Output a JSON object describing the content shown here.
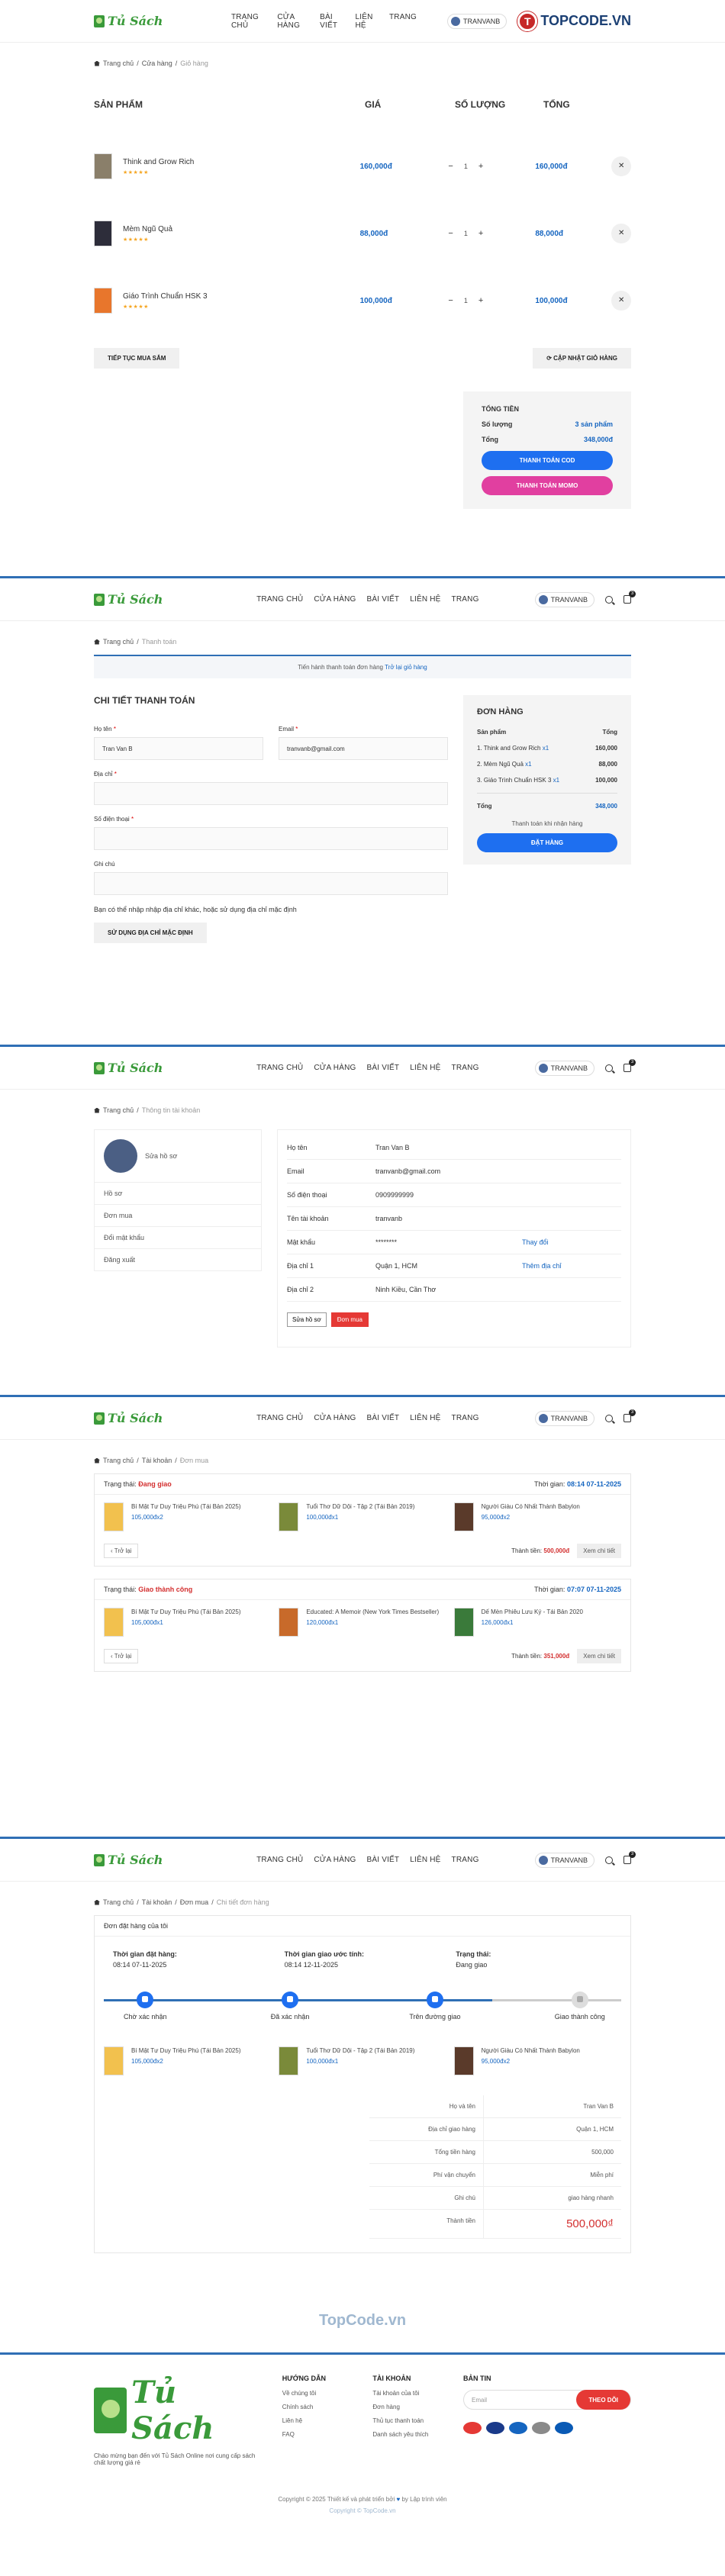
{
  "header": {
    "logo": "Tủ Sách",
    "nav": [
      "TRANG CHỦ",
      "CỬA HÀNG",
      "BÀI VIẾT",
      "LIÊN HỆ",
      "TRANG"
    ],
    "user": "TRANVANB",
    "cart_count": "3",
    "topcode": "TOPCODE.VN"
  },
  "cart": {
    "breadcrumb": [
      "Trang chủ",
      "Cửa hàng",
      "Giỏ hàng"
    ],
    "cols": [
      "SẢN PHẨM",
      "GIÁ",
      "SỐ LƯỢNG",
      "TỔNG"
    ],
    "items": [
      {
        "name": "Think and Grow Rich",
        "price": "160,000đ",
        "qty": "1",
        "total": "160,000đ",
        "color": "#8a7f6a"
      },
      {
        "name": "Mèm Ngũ Quả",
        "price": "88,000đ",
        "qty": "1",
        "total": "88,000đ",
        "color": "#2d2d3a"
      },
      {
        "name": "Giáo Trình Chuẩn HSK 3",
        "price": "100,000đ",
        "qty": "1",
        "total": "100,000đ",
        "color": "#e8762c"
      }
    ],
    "stars": "★★★★★",
    "minus": "−",
    "plus": "+",
    "remove": "✕",
    "continue": "TIẾP TỤC MUA SẮM",
    "update": "⟳ CẬP NHẬT GIỎ HÀNG",
    "totals_title": "TỔNG TIỀN",
    "qty_label": "Số lượng",
    "qty_value": "3 sản phẩm",
    "total_label": "Tổng",
    "total_value": "348,000đ",
    "cod": "THANH TOÁN COD",
    "momo": "THANH TOÁN MOMO"
  },
  "checkout": {
    "breadcrumb": [
      "Trang chủ",
      "Thanh toán"
    ],
    "notice": "Tiến hành thanh toán đơn hàng",
    "notice_link": "Trở lại giỏ hàng",
    "title": "CHI TIẾT THANH TOÁN",
    "name_label": "Họ tên",
    "name_value": "Tran Van B",
    "email_label": "Email",
    "email_value": "tranvanb@gmail.com",
    "address_label": "Địa chỉ",
    "phone_label": "Số điện thoại",
    "note_label": "Ghi chú",
    "alt_note": "Bạn có thể nhập nhập địa chỉ khác, hoặc sử dụng địa chỉ mặc định",
    "use_default": "SỬ DỤNG ĐỊA CHỈ MẶC ĐỊNH",
    "order_title": "ĐƠN HÀNG",
    "col_product": "Sản phẩm",
    "col_total": "Tổng",
    "lines": [
      {
        "name": "1. Think and Grow Rich",
        "qty": "x1",
        "price": "160,000"
      },
      {
        "name": "2. Mèm Ngũ Quả",
        "qty": "x1",
        "price": "88,000"
      },
      {
        "name": "3. Giáo Trình Chuẩn HSK 3",
        "qty": "x1",
        "price": "100,000"
      }
    ],
    "sum_label": "Tổng",
    "sum_value": "348,000",
    "pay_method": "Thanh toán khi nhận hàng",
    "place_order": "ĐẶT HÀNG"
  },
  "account": {
    "breadcrumb": [
      "Trang chủ",
      "Thông tin tài khoản"
    ],
    "edit": "Sửa hồ sơ",
    "menu": [
      "Hồ sơ",
      "Đơn mua",
      "Đổi mật khẩu",
      "Đăng xuất"
    ],
    "rows": [
      {
        "k": "Họ tên",
        "v": "Tran Van B",
        "a": ""
      },
      {
        "k": "Email",
        "v": "tranvanb@gmail.com",
        "a": ""
      },
      {
        "k": "Số điện thoại",
        "v": "0909999999",
        "a": ""
      },
      {
        "k": "Tên tài khoản",
        "v": "tranvanb",
        "a": ""
      },
      {
        "k": "Mật khẩu",
        "v": "********",
        "a": "Thay đổi"
      },
      {
        "k": "Địa chỉ 1",
        "v": "Quận 1, HCM",
        "a": "Thêm địa chỉ"
      },
      {
        "k": "Địa chỉ 2",
        "v": "Ninh Kiều, Cần Thơ",
        "a": ""
      }
    ],
    "btn_edit": "Sửa hồ sơ",
    "btn_orders": "Đơn mua"
  },
  "orders": {
    "breadcrumb": [
      "Trang chủ",
      "Tài khoản",
      "Đơn mua"
    ],
    "status_label": "Trạng thái:",
    "time_label": "Thời gian:",
    "total_label": "Thành tiền:",
    "back": "‹ Trở lại",
    "view": "Xem chi tiết",
    "list": [
      {
        "status": "Đang giao",
        "time": "08:14 07-11-2025",
        "total": "500,000đ",
        "items": [
          {
            "name": "Bí Mật Tư Duy Triệu Phú (Tái Bản 2025)",
            "price": "105,000đ",
            "qty": "x2",
            "color": "#f2c14e"
          },
          {
            "name": "Tuổi Thơ Dữ Dội - Tập 2 (Tái Bản 2019)",
            "price": "100,000đ",
            "qty": "x1",
            "color": "#7a8a3a"
          },
          {
            "name": "Người Giàu Có Nhất Thành Babylon",
            "price": "95,000đ",
            "qty": "x2",
            "color": "#5a3a2a"
          }
        ]
      },
      {
        "status": "Giao thành công",
        "time": "07:07 07-11-2025",
        "total": "351,000đ",
        "items": [
          {
            "name": "Bí Mật Tư Duy Triệu Phú (Tái Bản 2025)",
            "price": "105,000đ",
            "qty": "x1",
            "color": "#f2c14e"
          },
          {
            "name": "Educated: A Memoir (New York Times Bestseller)",
            "price": "120,000đ",
            "qty": "x1",
            "color": "#c86a2a"
          },
          {
            "name": "Dế Mèn Phiêu Lưu Ký - Tái Bản 2020",
            "price": "126,000đ",
            "qty": "x1",
            "color": "#3a7a3a"
          }
        ]
      }
    ]
  },
  "detail": {
    "breadcrumb": [
      "Trang chủ",
      "Tài khoản",
      "Đơn mua",
      "Chi tiết đơn hàng"
    ],
    "title": "Đơn đặt hàng của tôi",
    "placed_label": "Thời gian đặt hàng:",
    "placed": "08:14 07-11-2025",
    "eta_label": "Thời gian giao ước tính:",
    "eta": "08:14 12-11-2025",
    "status_label": "Trạng thái:",
    "status": "Đang giao",
    "steps": [
      "Chờ xác nhận",
      "Đã xác nhận",
      "Trên đường giao",
      "Giao thành công"
    ],
    "summary": [
      {
        "k": "Họ và tên",
        "v": "Tran Van B"
      },
      {
        "k": "Địa chỉ giao hàng",
        "v": "Quận 1, HCM"
      },
      {
        "k": "Tổng tiền hàng",
        "v": "500,000"
      },
      {
        "k": "Phí vận chuyển",
        "v": "Miễn phí"
      },
      {
        "k": "Ghi chú",
        "v": "giao hàng nhanh"
      }
    ],
    "grand_label": "Thành tiền",
    "grand": "500,000₫"
  },
  "footer": {
    "watermark": "TopCode.vn",
    "watermark2": "Copyright © TopCode.vn",
    "logo": "Tủ Sách",
    "tagline": "Chào mừng bạn đến với Tủ Sách Online nơi cung cấp sách chất lượng giá rẻ",
    "col1_title": "HƯỚNG DẪN",
    "col1": [
      "Về chúng tôi",
      "Chính sách",
      "Liên hệ",
      "FAQ"
    ],
    "col2_title": "TÀI KHOẢN",
    "col2": [
      "Tài khoản của tôi",
      "Đơn hàng",
      "Thủ tục thanh toán",
      "Danh sách yêu thích"
    ],
    "col3_title": "BẢN TIN",
    "email_ph": "Email",
    "subscribe": "THEO DÕI",
    "card_colors": [
      "#e53935",
      "#1a3a8a",
      "#1565c0",
      "#8a8a8a",
      "#0a5ab5"
    ],
    "copyright": "Copyright © 2025 Thiết kế và phát triển bởi",
    "copyright_by": "by Lập trình viên"
  }
}
